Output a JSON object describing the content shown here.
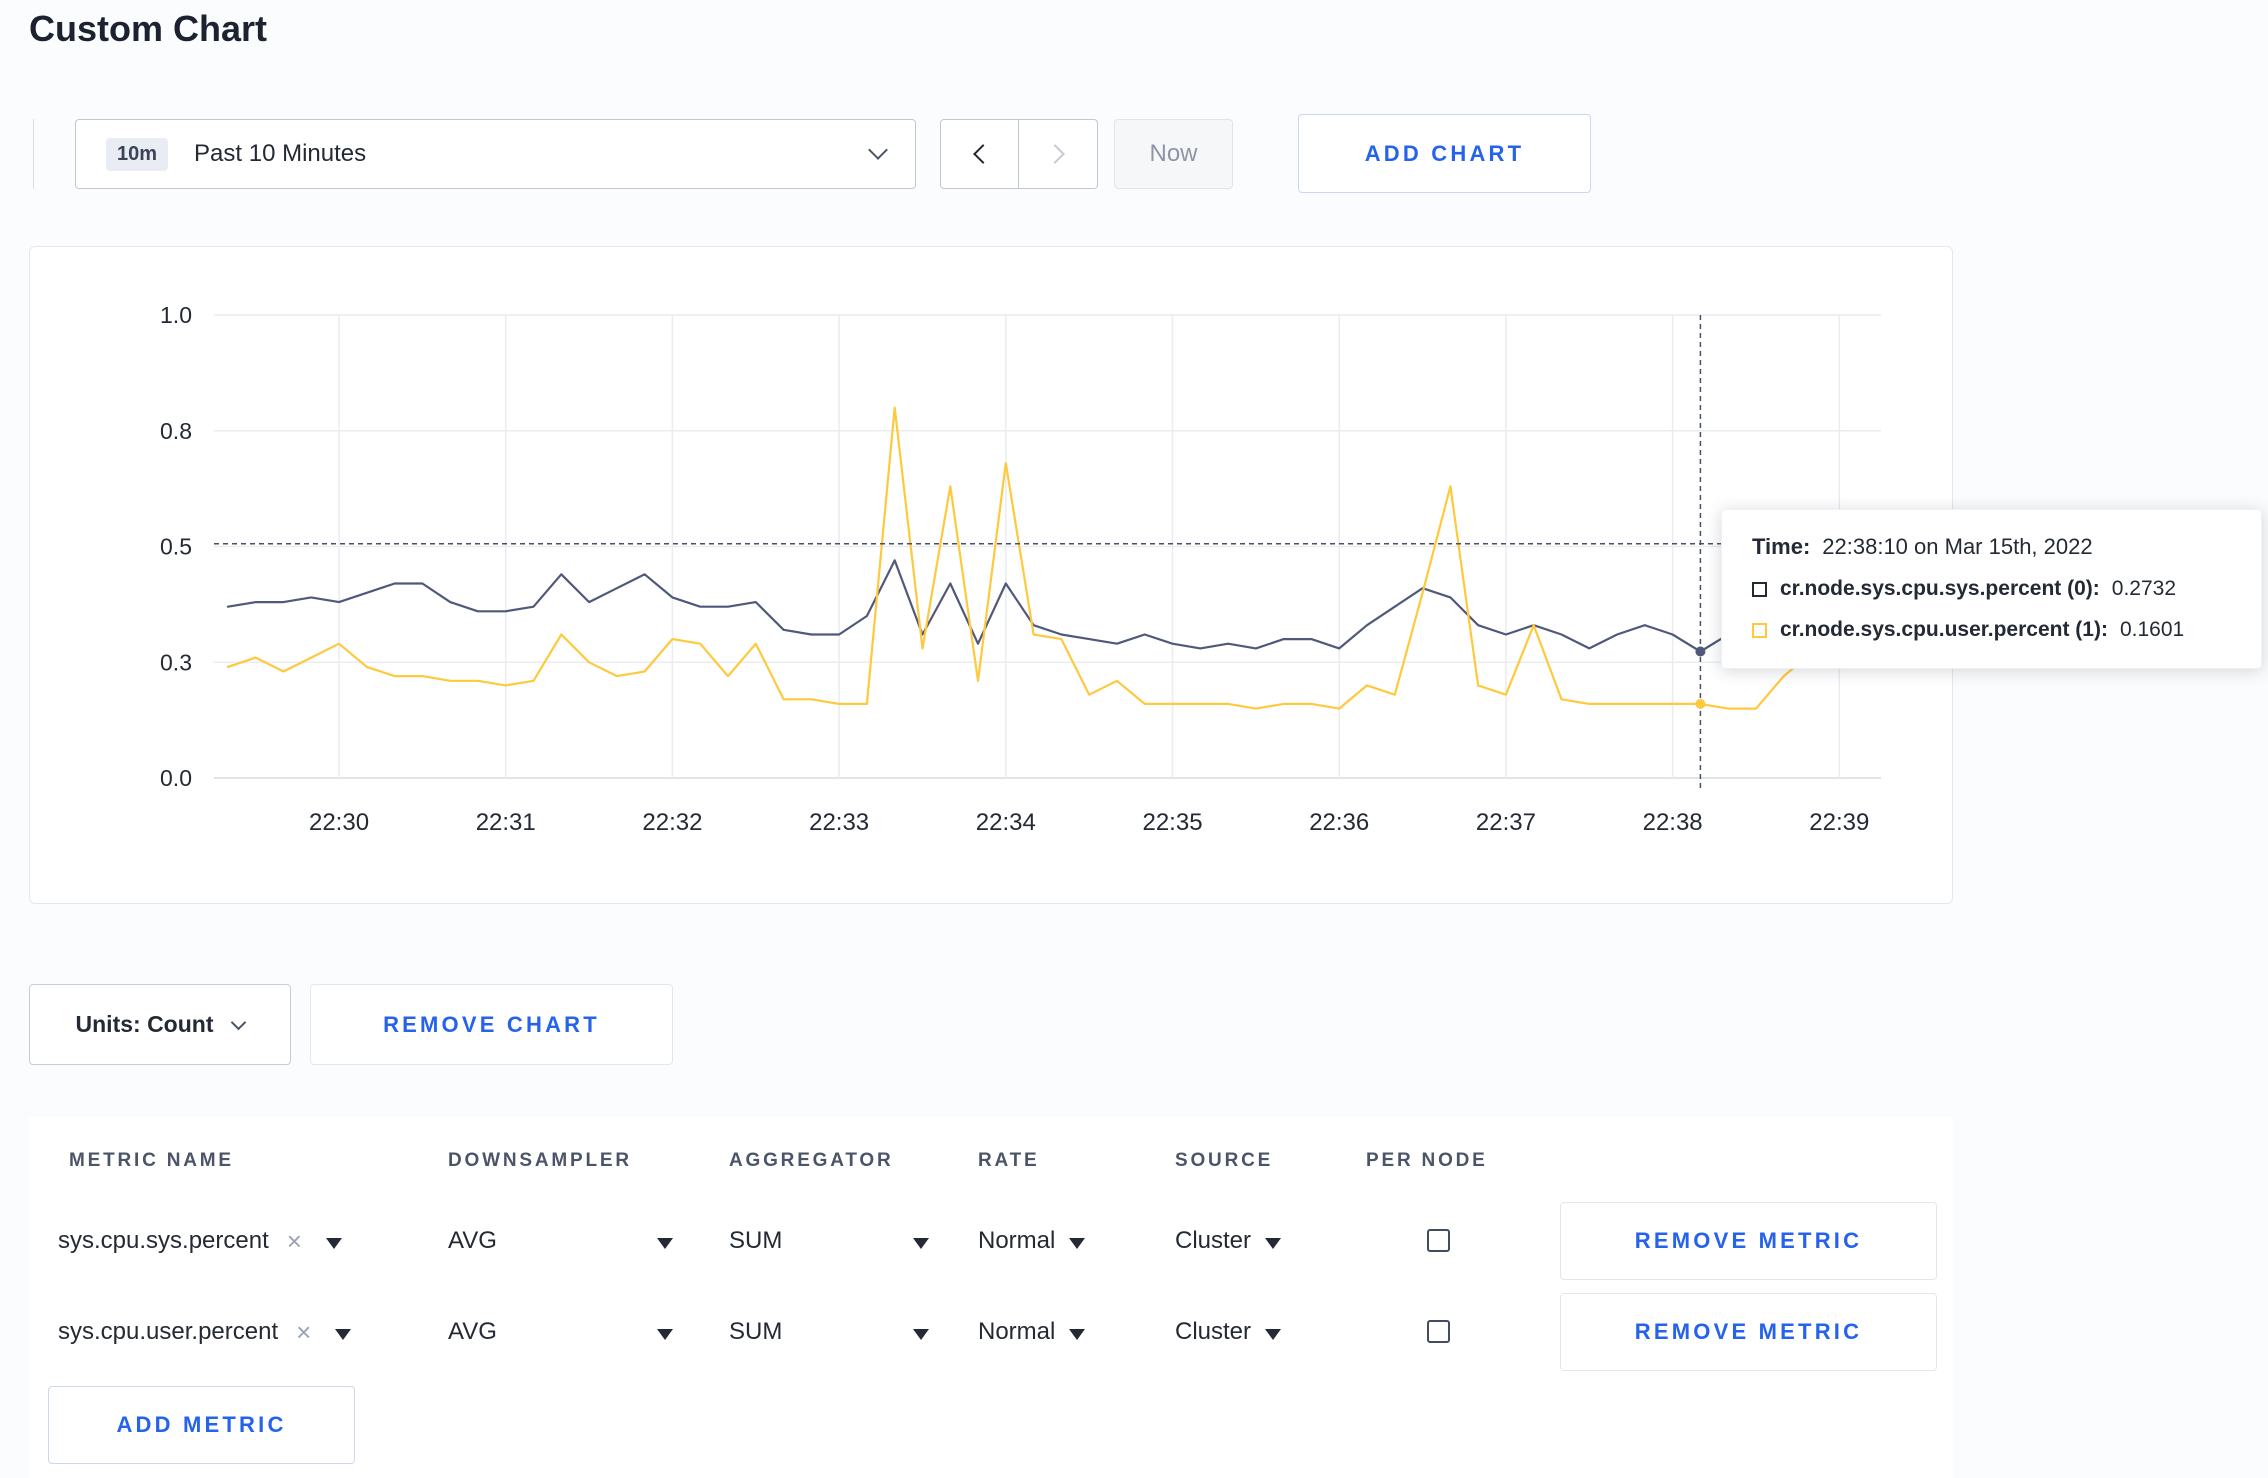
{
  "page": {
    "title": "Custom Chart"
  },
  "toolbar": {
    "time_badge": "10m",
    "time_label": "Past 10 Minutes",
    "now_label": "Now",
    "add_chart_label": "ADD CHART"
  },
  "chart": {
    "units_label": "Units: Count",
    "remove_chart_label": "REMOVE CHART"
  },
  "icons": {
    "clear": "×"
  },
  "colors": {
    "accent_blue": "#2563eb",
    "grid": "#eaecef",
    "axis_bottom": "#d8dbe1",
    "crosshair": "#44506a",
    "text_dark": "#242a35",
    "series_sys": "#50597a",
    "series_user": "#ffc93e"
  },
  "chart_data": {
    "type": "line",
    "title": "",
    "xlabel": "",
    "ylabel": "",
    "legend_position": "tooltip",
    "grid": true,
    "y_axis": {
      "min": 0,
      "max": 1,
      "ticks": [
        0,
        0.25,
        0.5,
        0.75,
        1
      ],
      "tick_labels": [
        "0.0",
        "0.3",
        "0.5",
        "0.8",
        "1.0"
      ]
    },
    "x_axis": {
      "domain_start": "22:29:15",
      "domain_seconds": 600,
      "tick_seconds": [
        45,
        105,
        165,
        225,
        285,
        345,
        405,
        465,
        525,
        585
      ],
      "tick_labels": [
        "22:30",
        "22:31",
        "22:32",
        "22:33",
        "22:34",
        "22:35",
        "22:36",
        "22:37",
        "22:38",
        "22:39"
      ]
    },
    "sample_start_offset_seconds": 5,
    "sample_step_seconds": 10,
    "series": [
      {
        "name": "cr.node.sys.cpu.sys.percent",
        "color": "#50597a",
        "values": [
          0.37,
          0.38,
          0.38,
          0.39,
          0.38,
          0.4,
          0.42,
          0.42,
          0.38,
          0.36,
          0.36,
          0.37,
          0.44,
          0.38,
          0.41,
          0.44,
          0.39,
          0.37,
          0.37,
          0.38,
          0.32,
          0.31,
          0.31,
          0.35,
          0.47,
          0.31,
          0.42,
          0.29,
          0.42,
          0.33,
          0.31,
          0.3,
          0.29,
          0.31,
          0.29,
          0.28,
          0.29,
          0.28,
          0.3,
          0.3,
          0.28,
          0.33,
          0.37,
          0.41,
          0.39,
          0.33,
          0.31,
          0.33,
          0.31,
          0.28,
          0.31,
          0.33,
          0.31,
          0.2732,
          0.31,
          0.3,
          0.3,
          0.31,
          0.3,
          0.31
        ]
      },
      {
        "name": "cr.node.sys.cpu.user.percent",
        "color": "#ffc93e",
        "values": [
          0.24,
          0.26,
          0.23,
          0.26,
          0.29,
          0.24,
          0.22,
          0.22,
          0.21,
          0.21,
          0.2,
          0.21,
          0.31,
          0.25,
          0.22,
          0.23,
          0.3,
          0.29,
          0.22,
          0.29,
          0.17,
          0.17,
          0.16,
          0.16,
          0.8,
          0.28,
          0.63,
          0.21,
          0.68,
          0.31,
          0.3,
          0.18,
          0.21,
          0.16,
          0.16,
          0.16,
          0.16,
          0.15,
          0.16,
          0.16,
          0.15,
          0.2,
          0.18,
          0.4,
          0.63,
          0.2,
          0.18,
          0.33,
          0.17,
          0.16,
          0.16,
          0.16,
          0.16,
          0.1601,
          0.15,
          0.15,
          0.22,
          0.27,
          0.24,
          0.28
        ]
      }
    ],
    "crosshair": {
      "t_seconds": 535,
      "hover_value": 0.506,
      "points": [
        {
          "series": 0,
          "value": 0.2732
        },
        {
          "series": 1,
          "value": 0.1601
        }
      ]
    },
    "tooltip": {
      "time_label": "Time:",
      "time_value": "22:38:10 on Mar 15th, 2022",
      "rows": [
        {
          "label": "cr.node.sys.cpu.sys.percent (0):",
          "value": "0.2732",
          "swatch": "#242a35"
        },
        {
          "label": "cr.node.sys.cpu.user.percent (1):",
          "value": "0.1601",
          "swatch": "#ffc93e"
        }
      ]
    }
  },
  "metrics_table": {
    "headers": [
      "METRIC NAME",
      "DOWNSAMPLER",
      "AGGREGATOR",
      "RATE",
      "SOURCE",
      "PER NODE"
    ],
    "rows": [
      {
        "metric": "sys.cpu.sys.percent",
        "downsampler": "AVG",
        "aggregator": "SUM",
        "rate": "Normal",
        "source": "Cluster",
        "per_node_checked": false,
        "remove_label": "REMOVE METRIC"
      },
      {
        "metric": "sys.cpu.user.percent",
        "downsampler": "AVG",
        "aggregator": "SUM",
        "rate": "Normal",
        "source": "Cluster",
        "per_node_checked": false,
        "remove_label": "REMOVE METRIC"
      }
    ],
    "add_metric_label": "ADD METRIC"
  }
}
